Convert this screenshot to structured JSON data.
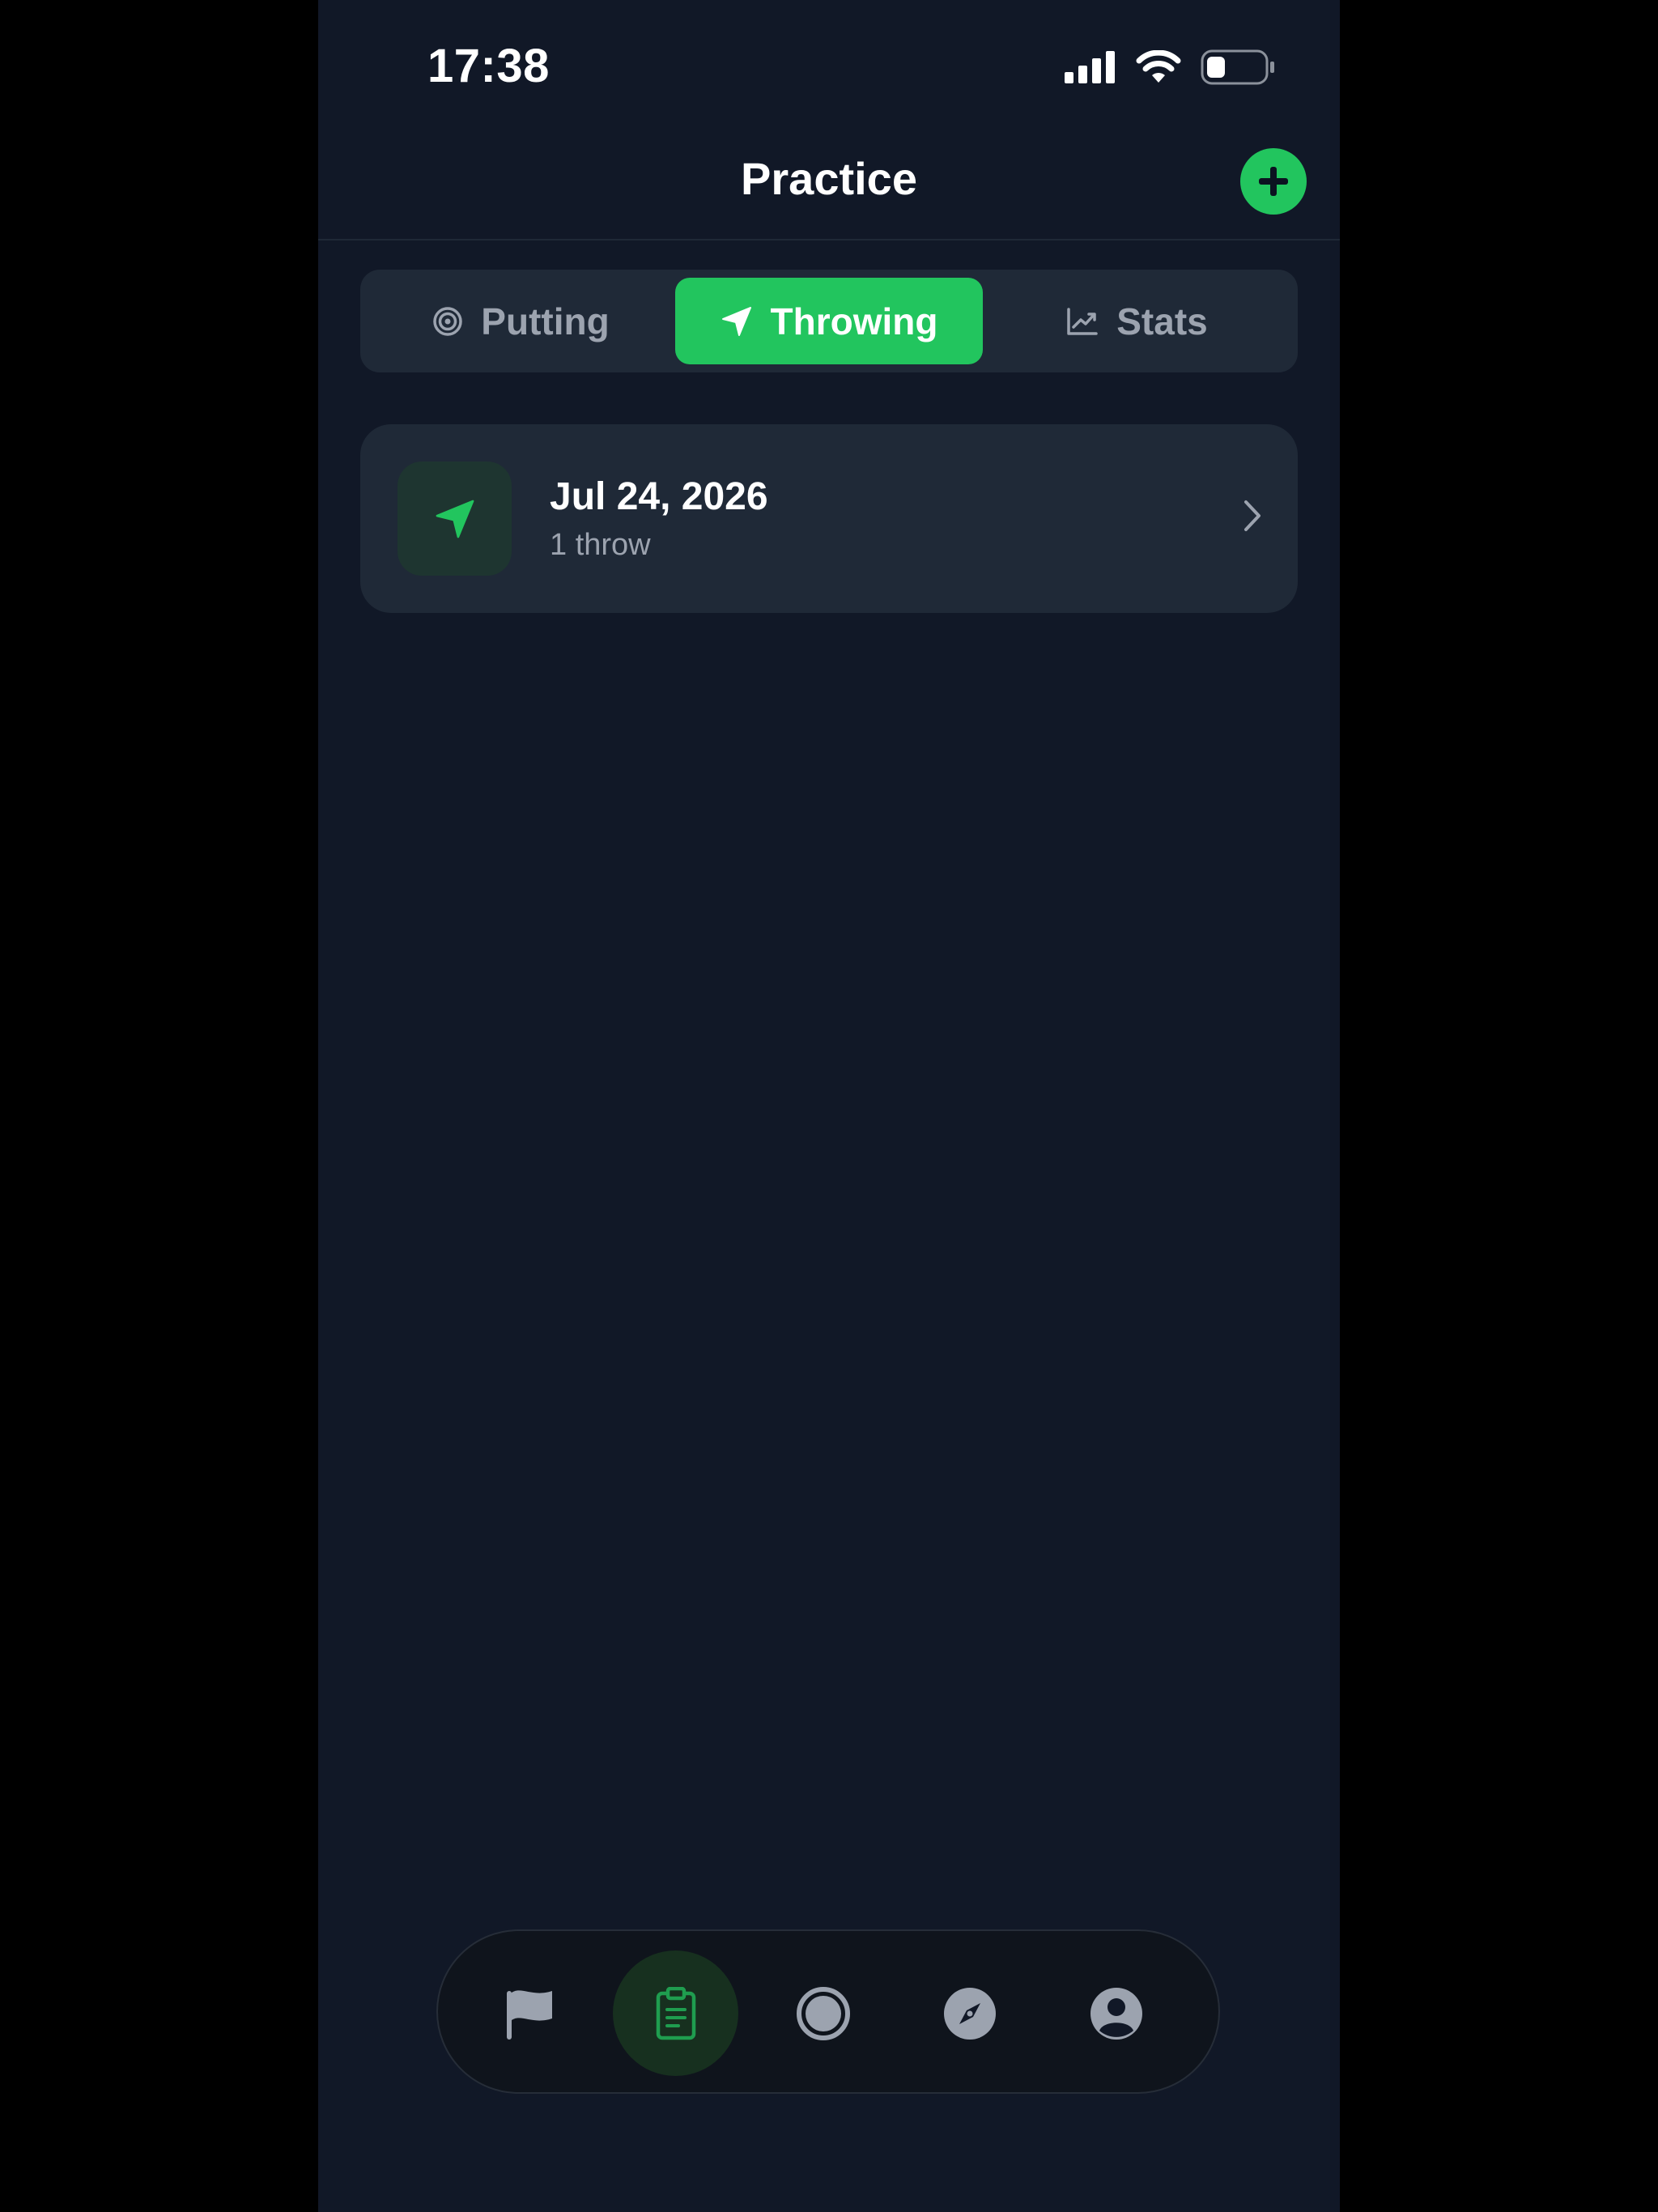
{
  "status_bar": {
    "time": "17:38"
  },
  "header": {
    "title": "Practice"
  },
  "tabs": [
    {
      "label": "Putting",
      "icon": "target-icon",
      "active": false
    },
    {
      "label": "Throwing",
      "icon": "navigation-arrow-icon",
      "active": true
    },
    {
      "label": "Stats",
      "icon": "chart-line-icon",
      "active": false
    }
  ],
  "sessions": [
    {
      "date": "Jul 24, 2026",
      "summary": "1 throw",
      "icon": "navigation-arrow-icon"
    }
  ],
  "bottom_nav": [
    {
      "icon": "flag-icon",
      "active": false
    },
    {
      "icon": "clipboard-icon",
      "active": true
    },
    {
      "icon": "disc-icon",
      "active": false
    },
    {
      "icon": "compass-icon",
      "active": false
    },
    {
      "icon": "user-icon",
      "active": false
    }
  ],
  "colors": {
    "accent": "#22c55e",
    "background": "#111827",
    "card": "#1f2937",
    "muted": "#9ca3af"
  }
}
